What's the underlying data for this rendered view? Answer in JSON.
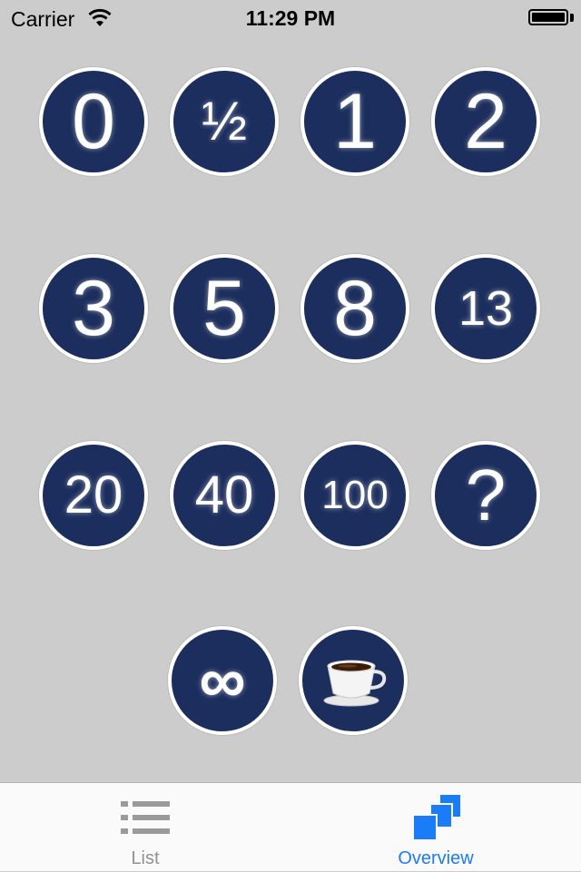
{
  "status_bar": {
    "carrier": "Carrier",
    "time": "11:29 PM"
  },
  "cards": [
    {
      "label": "0",
      "name": "card-0"
    },
    {
      "label": "½",
      "name": "card-half"
    },
    {
      "label": "1",
      "name": "card-1"
    },
    {
      "label": "2",
      "name": "card-2"
    },
    {
      "label": "3",
      "name": "card-3"
    },
    {
      "label": "5",
      "name": "card-5"
    },
    {
      "label": "8",
      "name": "card-8"
    },
    {
      "label": "13",
      "name": "card-13"
    },
    {
      "label": "20",
      "name": "card-20"
    },
    {
      "label": "40",
      "name": "card-40"
    },
    {
      "label": "100",
      "name": "card-100"
    },
    {
      "label": "?",
      "name": "card-question"
    },
    {
      "label": "∞",
      "name": "card-infinity"
    },
    {
      "label": "",
      "name": "card-coffee",
      "icon": "coffee-cup-icon"
    }
  ],
  "tabs": [
    {
      "label": "List",
      "icon": "list-icon",
      "selected": false
    },
    {
      "label": "Overview",
      "icon": "overview-stack-icon",
      "selected": true
    }
  ],
  "colors": {
    "card_fill": "#1c2e5e",
    "background": "#cccccc",
    "accent": "#1a7cf6"
  }
}
